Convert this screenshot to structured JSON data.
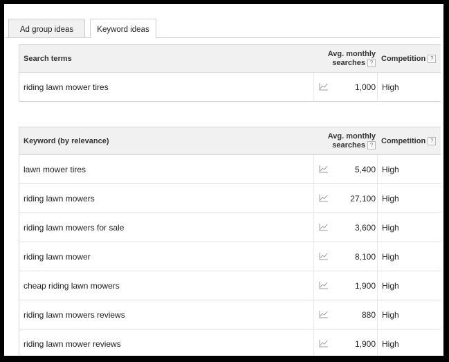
{
  "tabs": [
    {
      "label": "Ad group ideas",
      "active": false
    },
    {
      "label": "Keyword ideas",
      "active": true
    }
  ],
  "search_terms": {
    "headers": {
      "keyword": "Search terms",
      "avg_line1": "Avg. monthly",
      "avg_line2": "searches",
      "competition": "Competition",
      "help": "?"
    },
    "rows": [
      {
        "keyword": "riding lawn mower tires",
        "volume": "1,000",
        "competition": "High"
      }
    ]
  },
  "keyword_ideas": {
    "headers": {
      "keyword": "Keyword (by relevance)",
      "avg_line1": "Avg. monthly",
      "avg_line2": "searches",
      "competition": "Competition",
      "help": "?"
    },
    "rows": [
      {
        "keyword": "lawn mower tires",
        "volume": "5,400",
        "competition": "High"
      },
      {
        "keyword": "riding lawn mowers",
        "volume": "27,100",
        "competition": "High"
      },
      {
        "keyword": "riding lawn mowers for sale",
        "volume": "3,600",
        "competition": "High"
      },
      {
        "keyword": "riding lawn mower",
        "volume": "8,100",
        "competition": "High"
      },
      {
        "keyword": "cheap riding lawn mowers",
        "volume": "1,900",
        "competition": "High"
      },
      {
        "keyword": "riding lawn mowers reviews",
        "volume": "880",
        "competition": "High"
      },
      {
        "keyword": "riding lawn mower reviews",
        "volume": "1,900",
        "competition": "High"
      }
    ]
  }
}
